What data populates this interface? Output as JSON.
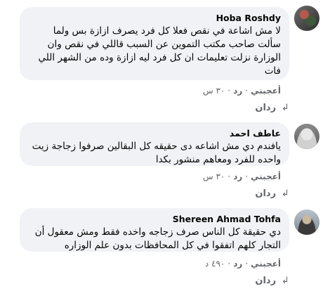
{
  "comments": [
    {
      "author": "Hoba Roshdy",
      "text": "لا مش اشاعة في نقص فعلا كل فرد يصرف ازازة بس ولما سألت صاحب مكتب التموين عن السبب قاللي في نقص وان الوزارة نزلت تعليمات ان كل فرد ليه ازازة وده من الشهر اللي فات",
      "like_label": "أعجبني",
      "reply_label": "رد",
      "time": "٣٠ س",
      "replies_label": "ردان"
    },
    {
      "author": "عاطف احمد",
      "text": "يافندم دي مش اشاعه دى حقيقه كل البقالين صرفوا زجاجة زيت واحده للفرد ومعاهم منشور بكدا",
      "like_label": "أعجبني",
      "reply_label": "رد",
      "time": "٣٠ س",
      "replies_label": "ردان"
    },
    {
      "author": "Shereen Ahmad Tohfa",
      "text": "دي حقيقة كل الناس صرف زجاجه واخده فقط ومش معقول أن التجار كلهم اتفقوا في كل المحافظات بدون علم الوزاره",
      "like_label": "أعجبني",
      "reply_label": "رد",
      "time": "٤٩٠ د",
      "replies_label": "ردان"
    }
  ]
}
